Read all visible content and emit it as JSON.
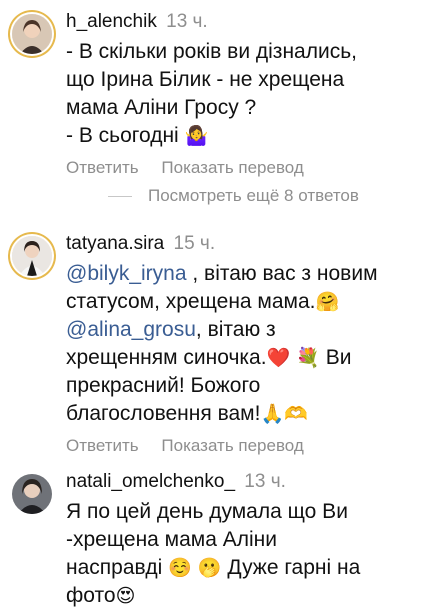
{
  "comments": [
    {
      "username": "h_alenchik",
      "time": "13 ч.",
      "lines": [
        "- В скільки років ви дізнались,",
        "що Ірина Білик - не хрещена",
        "мама Аліни Гросу ?",
        "- В сьогодні"
      ],
      "emoji_end": "🤷‍♀️"
    },
    {
      "username": "tatyana.sira",
      "time": "15 ч.",
      "mention1": "@bilyk_iryna",
      "text1": " , вітаю вас з новим",
      "text2": "статусом, хрещена мама.",
      "emoji1": "🤗",
      "mention2": "@alina_grosu",
      "text3": ", вітаю з",
      "text4": "хрещенням синочка.",
      "emoji2": "❤️ 💐",
      "text5": " Ви",
      "text6": "прекрасний! Божого",
      "text7": "благословення вам!",
      "emoji3": "🙏🫶"
    },
    {
      "username": "natali_omelchenko_",
      "time": "13 ч.",
      "line1": "Я по цей день думала що Ви",
      "line2": "-хрещена мама Аліни",
      "line3a": "насправді ",
      "emoji1": "☺️ 🫢",
      "line3b": " Дуже гарні на",
      "line4": "фото",
      "emoji2": "😍"
    }
  ],
  "actions": {
    "reply": "Ответить",
    "translate": "Показать перевод"
  },
  "more_replies": "Посмотреть ещё 8 ответов"
}
